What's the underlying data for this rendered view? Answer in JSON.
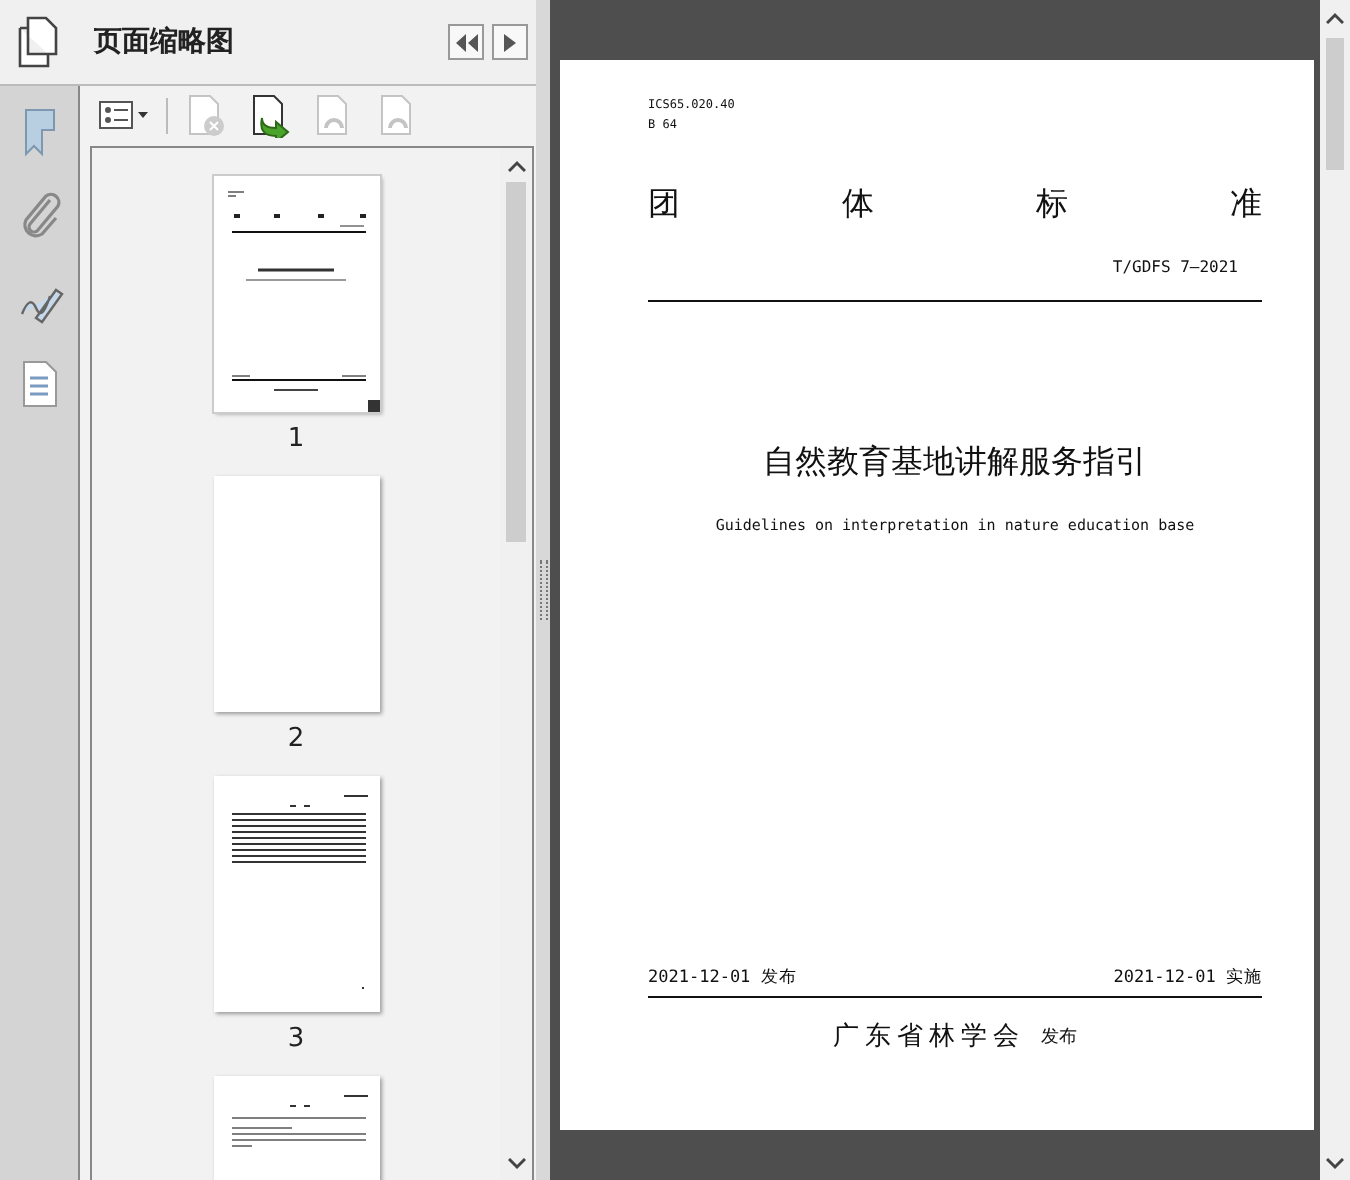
{
  "panel": {
    "title": "页面缩略图"
  },
  "toolbar": [
    {
      "kind": "options"
    },
    {
      "kind": "delete",
      "disabled": true
    },
    {
      "kind": "insert",
      "disabled": false
    },
    {
      "kind": "rotate-left",
      "disabled": true
    },
    {
      "kind": "rotate-right",
      "disabled": true
    }
  ],
  "rail": [
    {
      "kind": "bookmark"
    },
    {
      "kind": "attachment"
    },
    {
      "kind": "signature"
    },
    {
      "kind": "content"
    }
  ],
  "thumbnails": [
    {
      "label": "1",
      "kind": "cover",
      "selected": true
    },
    {
      "label": "2",
      "kind": "blank",
      "selected": false
    },
    {
      "label": "3",
      "kind": "contents",
      "selected": false
    },
    {
      "kind": "text",
      "selected": false
    }
  ],
  "document": {
    "codes": [
      "ICS65.020.40",
      "B 64"
    ],
    "heading": [
      "团",
      "体",
      "标",
      "准"
    ],
    "number": "T/GDFS 7—2021",
    "title": "自然教育基地讲解服务指引",
    "subtitle": "Guidelines on interpretation in nature education base",
    "issued": "2021-12-01 发布",
    "effective": "2021-12-01 实施",
    "publisher": "广东省林学会",
    "publisher_note": "发布"
  }
}
